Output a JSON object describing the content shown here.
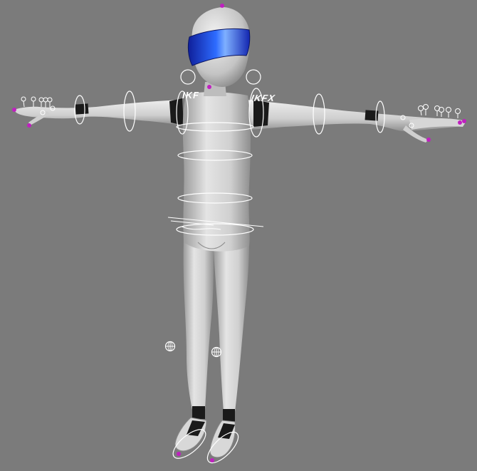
{
  "viewport": {
    "background": "#7b7b7b",
    "name": "3d-viewport"
  },
  "character": {
    "skin_color": "#c9c9c9",
    "visor_color": "#1f3fd8",
    "band_color": "#1a1a1a",
    "rig_control_color": "#ffffff",
    "pivot_color": "#c020c0"
  },
  "labels": {
    "ik_fk_right": "IKFX",
    "ik_fk_left": "IKF"
  }
}
